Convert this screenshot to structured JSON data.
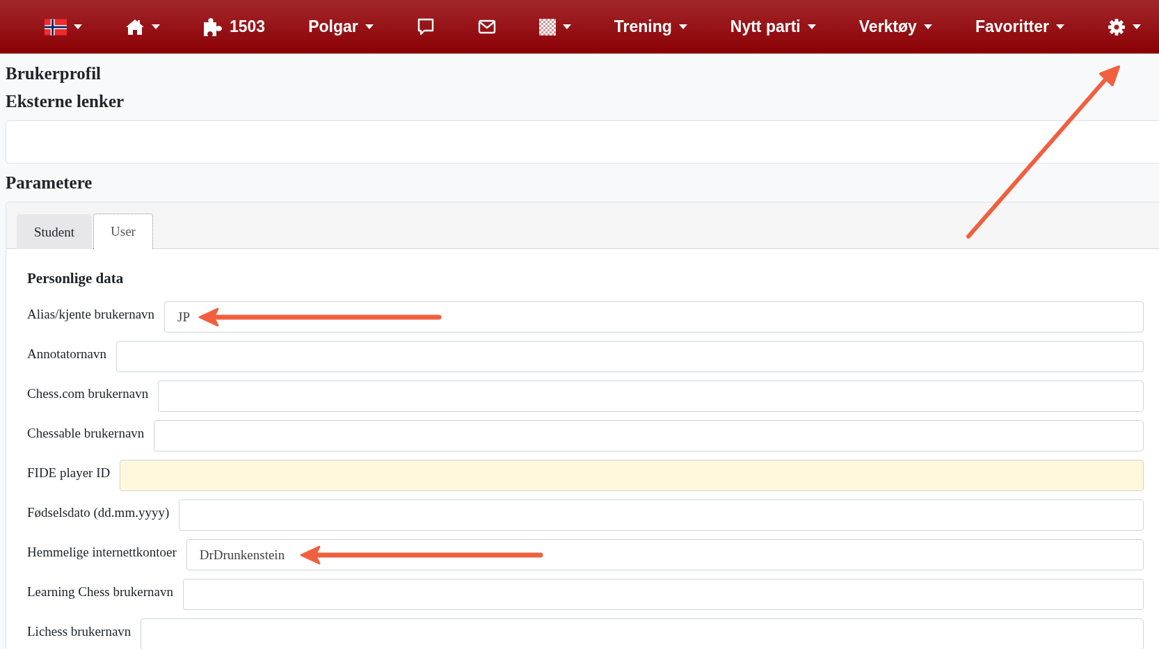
{
  "navbar": {
    "items": [
      {
        "kind": "flag",
        "caret": true
      },
      {
        "kind": "home",
        "caret": true
      },
      {
        "kind": "puzzle",
        "label": "1503",
        "caret": false
      },
      {
        "kind": "text",
        "label": "Polgar",
        "caret": true
      },
      {
        "kind": "chat",
        "caret": false
      },
      {
        "kind": "mail",
        "caret": false
      },
      {
        "kind": "board",
        "caret": true
      },
      {
        "kind": "text",
        "label": "Trening",
        "caret": true
      },
      {
        "kind": "text",
        "label": "Nytt parti",
        "caret": true
      },
      {
        "kind": "text",
        "label": "Verktøy",
        "caret": true
      },
      {
        "kind": "text",
        "label": "Favoritter",
        "caret": true
      },
      {
        "kind": "gear",
        "caret": true
      }
    ],
    "settings_arrow": true
  },
  "page_title": "Brukerprofil",
  "links_section": {
    "title": "Eksterne lenker"
  },
  "parameters": {
    "title": "Parametere",
    "tabs": [
      {
        "label": "Student",
        "selected": false
      },
      {
        "label": "User",
        "selected": true
      }
    ],
    "group_title": "Personlige data",
    "fields": [
      {
        "label": "Alias/kjente brukernavn",
        "value": "JP",
        "highlighted": false,
        "arrow": true
      },
      {
        "label": "Annotatornavn",
        "highlighted": false,
        "arrow": false
      },
      {
        "label": "Chess.com brukernavn",
        "highlighted": false,
        "arrow": false
      },
      {
        "label": "Chessable brukernavn",
        "highlighted": false,
        "arrow": false
      },
      {
        "label": "FIDE player ID",
        "highlighted": true,
        "arrow": false
      },
      {
        "label": "Fødselsdato (dd.mm.yyyy)",
        "highlighted": false,
        "arrow": false
      },
      {
        "label": "Hemmelige internettkontoer",
        "value": "DrDrunkenstein",
        "highlighted": false,
        "arrow": true
      },
      {
        "label": "Learning Chess brukernavn",
        "highlighted": false,
        "arrow": false
      },
      {
        "label": "Lichess brukernavn",
        "highlighted": false,
        "arrow": false
      }
    ]
  }
}
